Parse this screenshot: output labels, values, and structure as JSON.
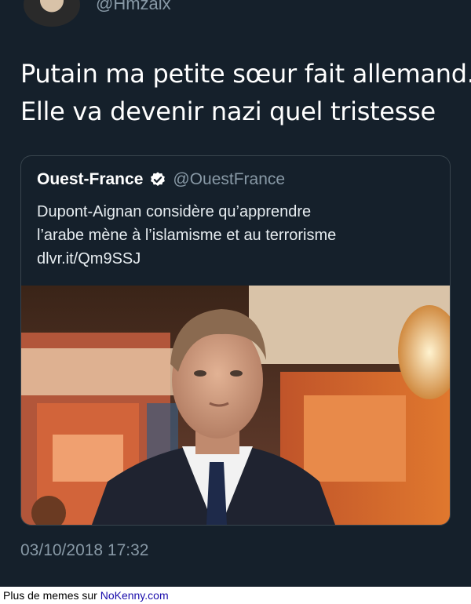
{
  "tweet": {
    "handle": "@Hmzaix",
    "text_lines": [
      "Putain ma petite sœur fait allemand..",
      "Elle va devenir nazi quel tristesse"
    ],
    "timestamp": "03/10/2018 17:32"
  },
  "quoted": {
    "name": "Ouest-France",
    "verified_icon": "verified-badge-icon",
    "handle": "@OuestFrance",
    "text_lines": [
      "Dupont-Aignan considère qu’apprendre",
      "l’arabe mène à l’islamisme et au terrorisme",
      "dlvr.it/Qm9SSJ"
    ]
  },
  "footer": {
    "prefix": "Plus de memes sur ",
    "link": "NoKenny.com"
  },
  "colors": {
    "background": "#15202b",
    "secondary_text": "#8899a6",
    "verified": "#ffffff",
    "link": "#1a0dab"
  }
}
